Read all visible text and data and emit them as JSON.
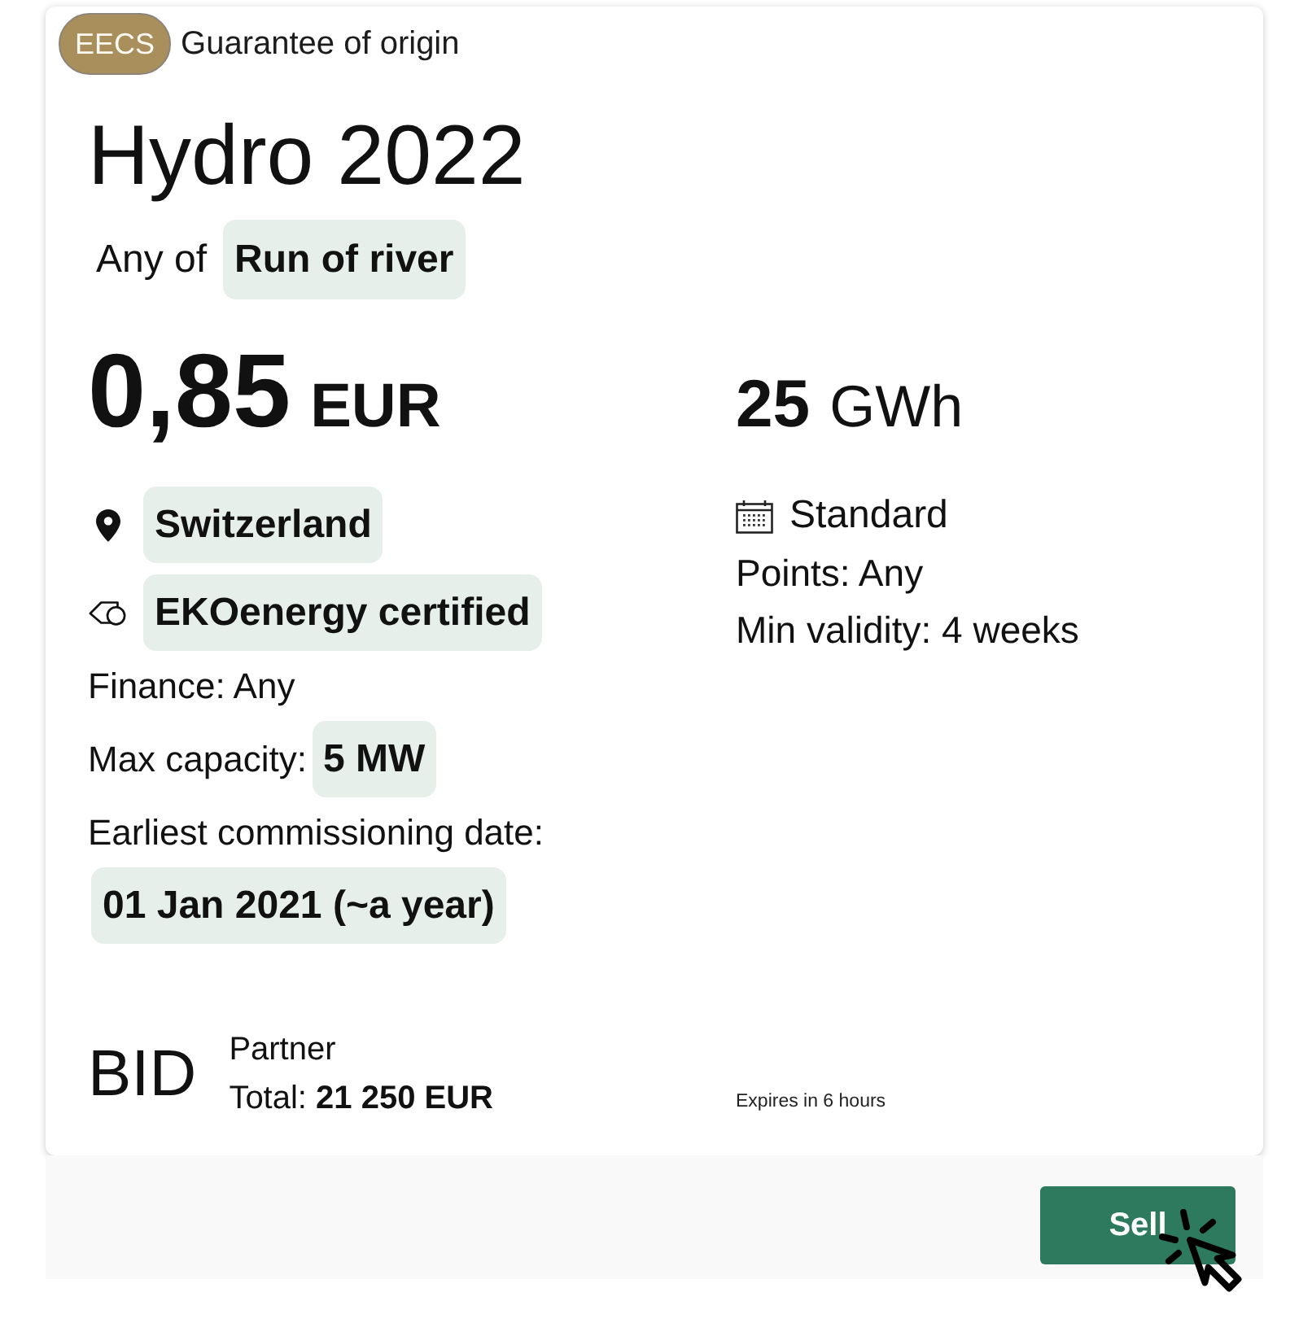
{
  "offer": {
    "scheme_badge": "EECS",
    "scheme_label": "Guarantee of origin",
    "title": "Hydro 2022",
    "technology": {
      "prefix": "Any of",
      "value": "Run of river"
    },
    "price": {
      "amount": "0,85",
      "currency": "EUR"
    },
    "volume": {
      "amount": "25",
      "unit": "GWh"
    },
    "attributes": [
      {
        "kind": "location",
        "value": "Switzerland"
      },
      {
        "kind": "label",
        "value": "EKOenergy certified"
      }
    ],
    "finance": "Finance: Any",
    "max_capacity": {
      "label": "Max capacity:",
      "value": "5 MW"
    },
    "commissioning": {
      "label": "Earliest commissioning date:",
      "value": "01 Jan 2021 (~a year)"
    },
    "details": [
      {
        "kind": "calendar",
        "text": "Standard"
      },
      {
        "kind": "plain",
        "text": "Points: Any"
      },
      {
        "kind": "plain",
        "text": "Min validity: 4 weeks"
      }
    ],
    "order": {
      "side": "BID",
      "counterparty": "Partner",
      "total": "Total: **21 250 EUR**"
    },
    "expiry": "Expires in 6 hours"
  },
  "actions": [
    {
      "label": "Sell"
    }
  ]
}
